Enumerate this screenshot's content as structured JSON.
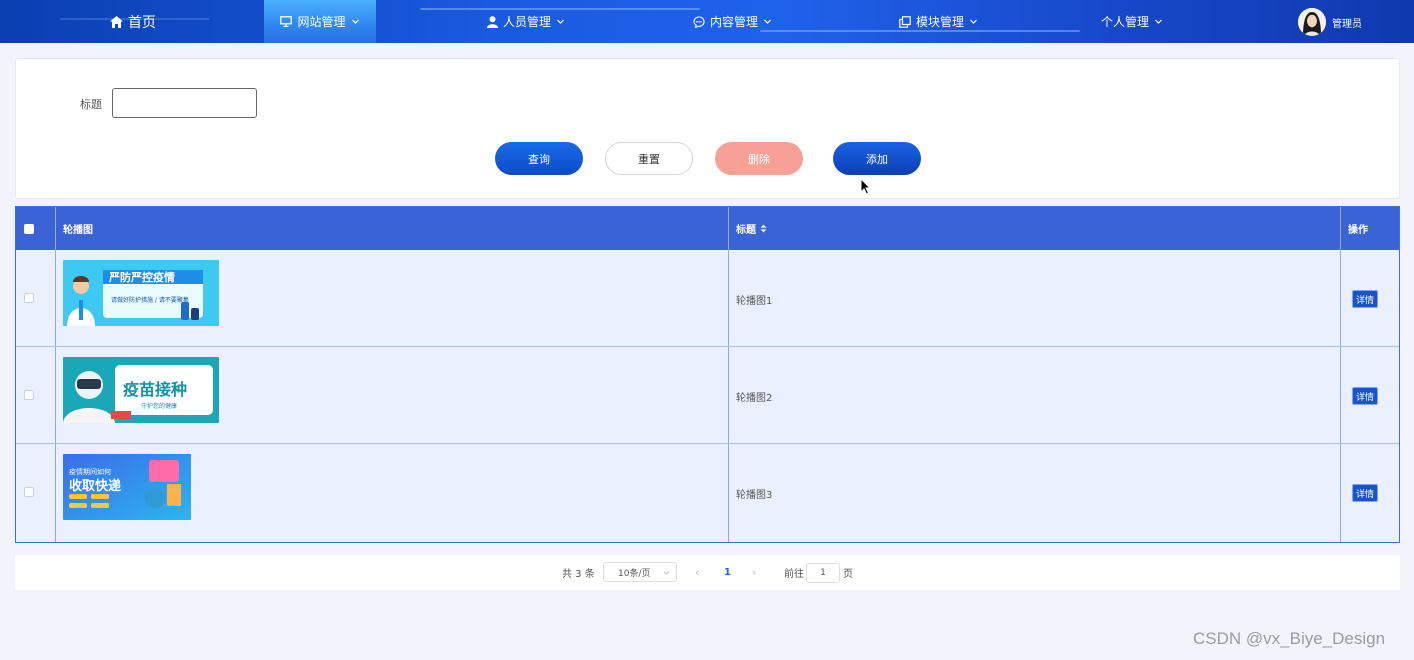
{
  "nav": {
    "items": [
      {
        "label": "首页",
        "icon": "home-icon"
      },
      {
        "label": "网站管理",
        "icon": "monitor-icon"
      },
      {
        "label": "人员管理",
        "icon": "user-icon"
      },
      {
        "label": "内容管理",
        "icon": "chat-icon"
      },
      {
        "label": "模块管理",
        "icon": "layers-icon"
      },
      {
        "label": "个人管理",
        "icon": ""
      }
    ],
    "active": "网站管理",
    "user_name": "管理员"
  },
  "search": {
    "title_label": "标题",
    "title_value": "",
    "buttons": {
      "query": "查询",
      "reset": "重置",
      "delete": "删除",
      "add": "添加"
    }
  },
  "table": {
    "columns": {
      "image": "轮播图",
      "title": "标题",
      "action": "操作"
    },
    "rows": [
      {
        "image_text": "严防严控疫情",
        "image_sub": "请做好防护措施 / 请不要聚集",
        "title": "轮播图1",
        "action": "详情"
      },
      {
        "image_text": "疫苗接种",
        "image_sub": "守护您的健康",
        "title": "轮播图2",
        "action": "详情"
      },
      {
        "image_text": "收取快递",
        "image_sub": "疫情期间如何",
        "title": "轮播图3",
        "action": "详情"
      }
    ]
  },
  "pagination": {
    "total": "共 3 条",
    "page_size": "10条/页",
    "current_page": "1",
    "goto_label": "前往",
    "goto_value": "1",
    "page_suffix": "页"
  },
  "colors": {
    "primary": "#1a55c8",
    "header": "#3a63d6",
    "danger_light": "#f7a096"
  },
  "watermark": "CSDN @vx_Biye_Design"
}
